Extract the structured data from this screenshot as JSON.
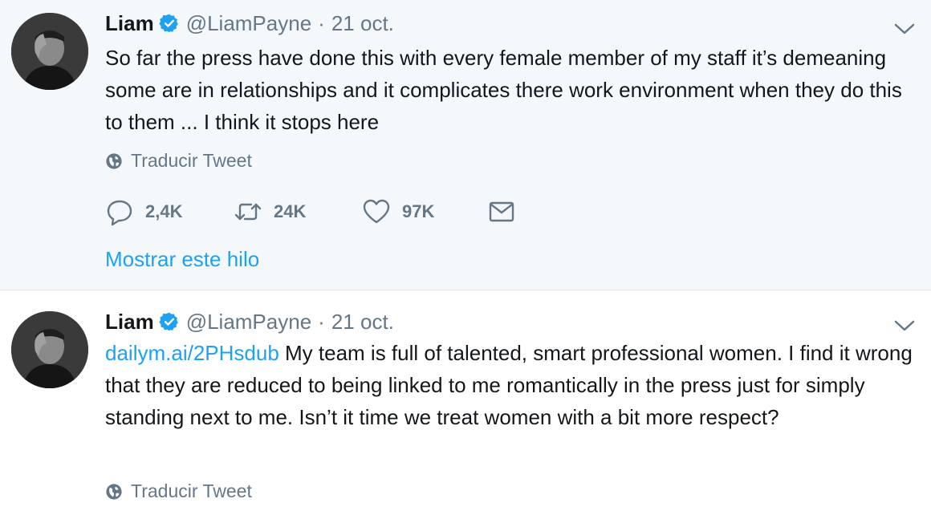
{
  "tweets": [
    {
      "author": {
        "name": "Liam",
        "handle": "@LiamPayne",
        "verified": true
      },
      "separator": "·",
      "time": "21 oct.",
      "text": "So far the press have done this with every female member of my staff it’s demeaning some are in relationships and it complicates there work environment when they do this to them ... I think it stops here",
      "translate_label": "Traducir Tweet",
      "stats": {
        "replies": "2,4K",
        "retweets": "24K",
        "likes": "97K"
      },
      "show_thread_label": "Mostrar este hilo"
    },
    {
      "author": {
        "name": "Liam",
        "handle": "@LiamPayne",
        "verified": true
      },
      "separator": "·",
      "time": "21 oct.",
      "link": "dailym.ai/2PHsdub",
      "text": " My team is full of talented, smart professional women. I find it wrong that they are reduced to being linked to me romantically in the press just for simply standing next to me. Isn’t it time we treat women with a bit more respect?",
      "translate_label": "Traducir Tweet"
    }
  ],
  "icons": {
    "verified": "verified-badge-icon",
    "caret": "chevron-down-icon",
    "globe": "globe-icon",
    "reply": "reply-icon",
    "retweet": "retweet-icon",
    "like": "heart-icon",
    "message": "direct-message-icon"
  },
  "colors": {
    "accent": "#1da1f2",
    "muted": "#657786",
    "text": "#14171a",
    "tweet_bg_highlight": "#f5f8fa"
  }
}
